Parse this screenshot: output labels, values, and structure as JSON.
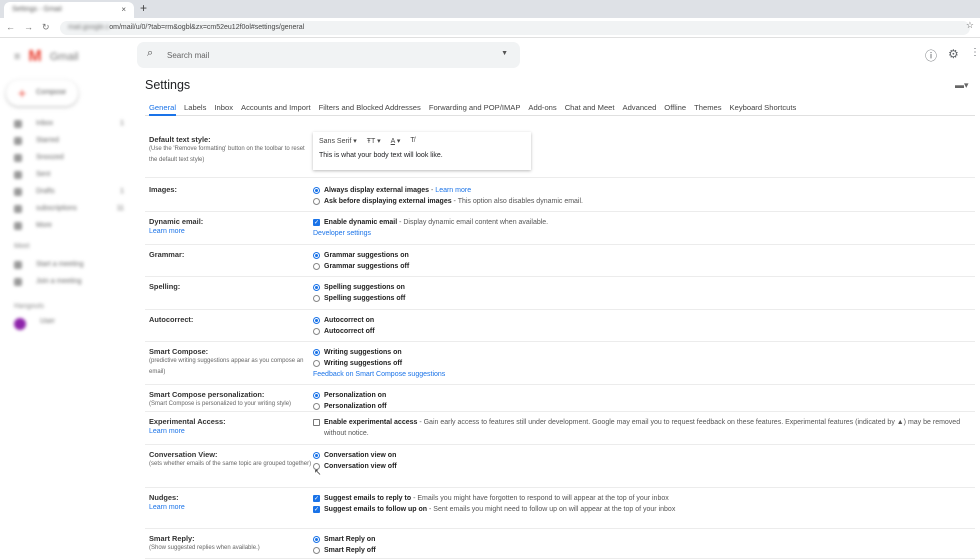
{
  "browser": {
    "tab_title": "Settings - Gmail",
    "new_tab": "+",
    "close": "×",
    "url_host": "mail.google.c",
    "url": "om/mail/u/0/?tab=rm&ogbl&zx=cm52eu12f0ol#settings/general"
  },
  "app": {
    "name": "Gmail",
    "search_placeholder": "Search mail",
    "compose": "Compose"
  },
  "sidebar": {
    "items": [
      {
        "label": "Inbox",
        "count": "1"
      },
      {
        "label": "Starred",
        "count": ""
      },
      {
        "label": "Snoozed",
        "count": ""
      },
      {
        "label": "Sent",
        "count": ""
      },
      {
        "label": "Drafts",
        "count": "1"
      },
      {
        "label": "subscriptions",
        "count": "11"
      },
      {
        "label": "More",
        "count": ""
      }
    ],
    "meet_heading": "Meet",
    "meet_items": [
      "Start a meeting",
      "Join a meeting"
    ],
    "hangouts_heading": "Hangouts",
    "hangouts_user": "User"
  },
  "page_title": "Settings",
  "tabs": [
    "General",
    "Labels",
    "Inbox",
    "Accounts and Import",
    "Filters and Blocked Addresses",
    "Forwarding and POP/IMAP",
    "Add-ons",
    "Chat and Meet",
    "Advanced",
    "Offline",
    "Themes",
    "Keyboard Shortcuts"
  ],
  "text_style": {
    "label": "Default text style:",
    "sub": "(Use the 'Remove formatting' button on the toolbar to reset the default text style)",
    "font": "Sans Serif",
    "preview": "This is what your body text will look like."
  },
  "rows": [
    {
      "label": "Images:",
      "options": [
        {
          "type": "radio",
          "checked": true,
          "label": "Always display external images",
          "desc": " - ",
          "link": "Learn more"
        },
        {
          "type": "radio",
          "checked": false,
          "label": "Ask before displaying external images",
          "desc": " - This option also disables dynamic email."
        }
      ]
    },
    {
      "label": "Dynamic email:",
      "label_link": "Learn more",
      "options": [
        {
          "type": "checkbox",
          "checked": true,
          "label": "Enable dynamic email",
          "desc": " - Display dynamic email content when available."
        },
        {
          "type": "link",
          "link": "Developer settings"
        }
      ]
    },
    {
      "label": "Grammar:",
      "options": [
        {
          "type": "radio",
          "checked": true,
          "label": "Grammar suggestions on"
        },
        {
          "type": "radio",
          "checked": false,
          "label": "Grammar suggestions off"
        }
      ]
    },
    {
      "label": "Spelling:",
      "options": [
        {
          "type": "radio",
          "checked": true,
          "label": "Spelling suggestions on"
        },
        {
          "type": "radio",
          "checked": false,
          "label": "Spelling suggestions off"
        }
      ]
    },
    {
      "label": "Autocorrect:",
      "options": [
        {
          "type": "radio",
          "checked": true,
          "label": "Autocorrect on"
        },
        {
          "type": "radio",
          "checked": false,
          "label": "Autocorrect off"
        }
      ]
    },
    {
      "label": "Smart Compose:",
      "sub": "(predictive writing suggestions appear as you compose an email)",
      "options": [
        {
          "type": "radio",
          "checked": true,
          "label": "Writing suggestions on"
        },
        {
          "type": "radio",
          "checked": false,
          "label": "Writing suggestions off"
        },
        {
          "type": "link",
          "link": "Feedback on Smart Compose suggestions"
        }
      ]
    },
    {
      "label": "Smart Compose personalization:",
      "sub": "(Smart Compose is personalized to your writing style)",
      "options": [
        {
          "type": "radio",
          "checked": true,
          "label": "Personalization on"
        },
        {
          "type": "radio",
          "checked": false,
          "label": "Personalization off"
        }
      ]
    },
    {
      "label": "Experimental Access:",
      "label_link": "Learn more",
      "options": [
        {
          "type": "checkbox",
          "checked": false,
          "label": "Enable experimental access",
          "desc": " - Gain early access to features still under development. Google may email you to request feedback on these features. Experimental features (indicated by ▲) may be removed without notice."
        }
      ]
    },
    {
      "label": "Conversation View:",
      "sub": "(sets whether emails of the same topic are grouped together)",
      "options": [
        {
          "type": "radio",
          "checked": true,
          "label": "Conversation view on"
        },
        {
          "type": "radio",
          "checked": false,
          "label": "Conversation view off"
        }
      ]
    },
    {
      "label": "Nudges:",
      "label_link": "Learn more",
      "options": [
        {
          "type": "checkbox",
          "checked": true,
          "label": "Suggest emails to reply to",
          "desc": " - Emails you might have forgotten to respond to will appear at the top of your inbox"
        },
        {
          "type": "checkbox",
          "checked": true,
          "label": "Suggest emails to follow up on",
          "desc": " - Sent emails you might need to follow up on will appear at the top of your inbox"
        }
      ]
    },
    {
      "label": "Smart Reply:",
      "sub": "(Show suggested replies when available.)",
      "options": [
        {
          "type": "radio",
          "checked": true,
          "label": "Smart Reply on"
        },
        {
          "type": "radio",
          "checked": false,
          "label": "Smart Reply off"
        }
      ]
    }
  ],
  "colors": {
    "accent": "#1a73e8"
  }
}
